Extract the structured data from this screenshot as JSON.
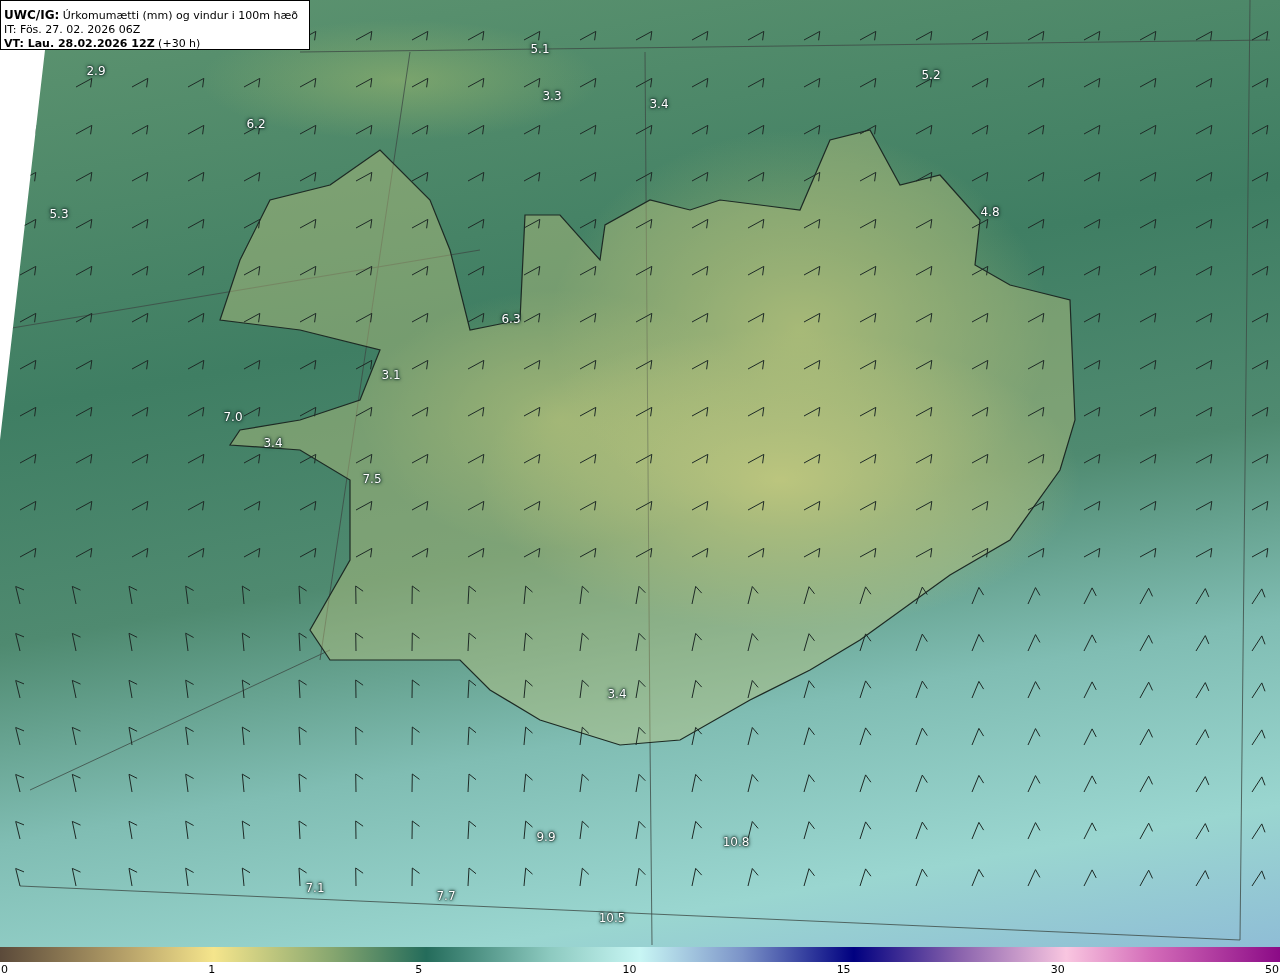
{
  "header": {
    "title": "**UWC/IG:** Úrkomumætti (mm) og vindur i 100m hæð",
    "init_time": "IT: Fös. 27. 02. 2026 06Z",
    "valid_time": "**VT: Lau. 28.02.2026 12Z** (+30 h)"
  },
  "map": {
    "value_labels": [
      "5.1",
      "2.9",
      "3.3",
      "3.4",
      "5.2",
      "6.2",
      "5.3",
      "4.8",
      "6.3",
      "3.1",
      "7.0",
      "3.4",
      "7.5",
      "3.4",
      "9.9",
      "10.8",
      "7.1",
      "7.7",
      "10.5"
    ]
  },
  "colorbar": {
    "ticks": [
      "0",
      "1",
      "5",
      "10",
      "15",
      "30",
      "50"
    ]
  }
}
